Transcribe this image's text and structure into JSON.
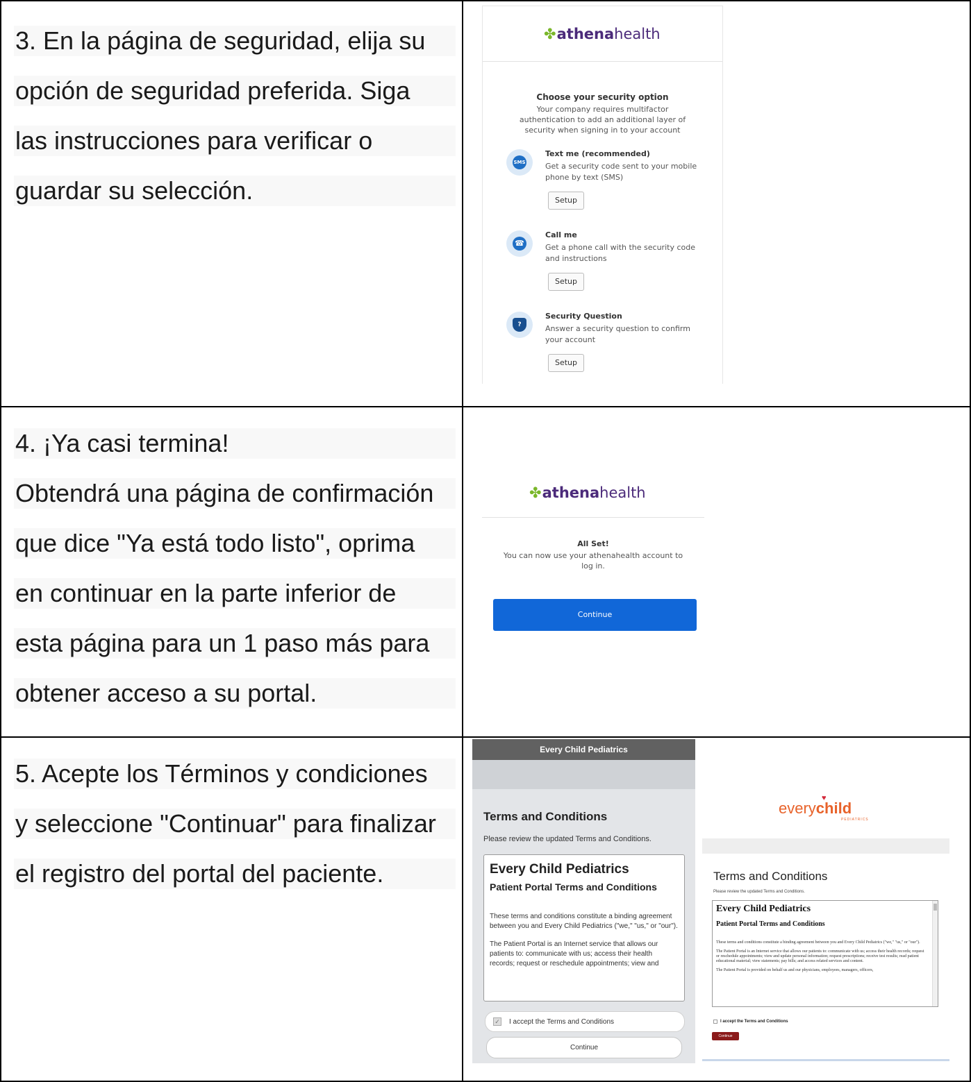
{
  "steps": [
    {
      "lines": [
        "3. En la página de seguridad, elija su",
        "opción de seguridad preferida. Siga",
        "las instrucciones para verificar o",
        "guardar su selección."
      ]
    },
    {
      "lines": [
        "4. ¡Ya casi termina!",
        "Obtendrá una página de confirmación",
        "que dice \"Ya está todo listo\", oprima",
        "en continuar en la parte inferior de",
        "esta página para un 1 paso más para",
        "obtener acceso a su portal."
      ]
    },
    {
      "lines": [
        "5. Acepte los Términos y condiciones",
        "y seleccione \"Continuar\" para finalizar",
        "el registro del portal del paciente."
      ]
    }
  ],
  "logo": {
    "leaf": "✤",
    "part1": "athena",
    "part2": "health"
  },
  "security": {
    "title": "Choose your security option",
    "subtitle_lines": [
      "Your company requires multifactor",
      "authentication to add an additional layer of",
      "security when signing in to your account"
    ],
    "options": [
      {
        "icon": "sms-icon",
        "icon_text": "SMS",
        "name": "Text me (recommended)",
        "desc": "Get a security code sent to your mobile phone by text (SMS)",
        "button": "Setup"
      },
      {
        "icon": "phone-icon",
        "icon_text": "☎",
        "name": "Call me",
        "desc": "Get a phone call with the security code and instructions",
        "button": "Setup"
      },
      {
        "icon": "shield-icon",
        "icon_text": "?",
        "name": "Security Question",
        "desc": "Answer a security question to confirm your account",
        "button": "Setup"
      }
    ]
  },
  "allset": {
    "title": "All Set!",
    "message_lines": [
      "You can now use your athenahealth account to",
      "log in."
    ],
    "button": "Continue"
  },
  "phone": {
    "header": "Every Child Pediatrics",
    "title": "Terms and Conditions",
    "subtitle": "Please review the updated Terms and Conditions.",
    "doc_title": "Every Child Pediatrics",
    "doc_subtitle": "Patient Portal Terms and Conditions",
    "para1": "These terms and conditions constitute a binding agreement between you and Every Child Pediatrics (\"we,\" \"us,\" or \"our\").",
    "para2": "The Patient Portal is an Internet service that allows our patients to: communicate with us; access their health records; request or reschedule appointments; view and",
    "checkbox_label": "I accept the Terms and Conditions",
    "button": "Continue"
  },
  "desktop": {
    "logo_part1": "every",
    "logo_part2": "chi",
    "logo_part3": "ld",
    "logo_sub": "PEDIATRICS",
    "title": "Terms and Conditions",
    "subtitle": "Please review the updated Terms and Conditions.",
    "doc_title": "Every Child Pediatrics",
    "doc_subtitle": "Patient Portal Terms and Conditions",
    "para1": "These terms and conditions constitute a binding agreement between you and Every Child Pediatrics (\"we,\" \"us,\" or \"our\").",
    "para2": "The Patient Portal is an Internet service that allows our patients to: communicate with us; access their health records; request or reschedule appointments; view and update personal information; request prescriptions; receive test results; read patient educational material; view statements; pay bills; and access related services and content.",
    "para3": "The Patient Portal is provided on behalf us and our physicians, employees, managers, officers,",
    "checkbox_label": "I accept the Terms and Conditions",
    "button": "Continue"
  },
  "colors": {
    "athena_purple": "#4b2a7a",
    "athena_green": "#7ab72a",
    "continue_blue": "#1167d8",
    "every_child_orange": "#e8632b",
    "every_child_red": "#8b1a1a"
  }
}
